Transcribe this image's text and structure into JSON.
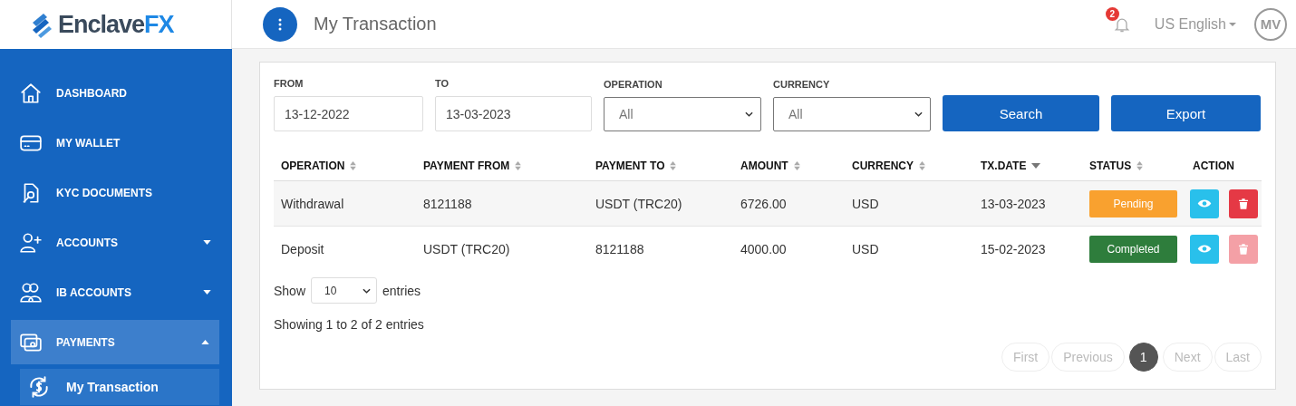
{
  "brand": {
    "name": "Enclave",
    "accent": "FX"
  },
  "header": {
    "title": "My Transaction",
    "notifications": "2",
    "language": "US English",
    "avatar": "MV"
  },
  "sidebar": {
    "items": [
      {
        "label": "DASHBOARD",
        "expandable": false,
        "selected": false
      },
      {
        "label": "MY WALLET",
        "expandable": false,
        "selected": false
      },
      {
        "label": "KYC DOCUMENTS",
        "expandable": false,
        "selected": false
      },
      {
        "label": "ACCOUNTS",
        "expandable": true,
        "expanded": false,
        "selected": false
      },
      {
        "label": "IB ACCOUNTS",
        "expandable": true,
        "expanded": false,
        "selected": false
      },
      {
        "label": "PAYMENTS",
        "expandable": true,
        "expanded": true,
        "selected": true,
        "children": [
          {
            "label": "My Transaction",
            "selected": true
          }
        ]
      }
    ]
  },
  "filters": {
    "from": {
      "label": "FROM",
      "value": "13-12-2022"
    },
    "to": {
      "label": "TO",
      "value": "13-03-2023"
    },
    "operation": {
      "label": "OPERATION",
      "value": "All"
    },
    "currency": {
      "label": "CURRENCY",
      "value": "All"
    },
    "buttons": [
      "Search",
      "Export"
    ]
  },
  "table": {
    "columns": [
      {
        "label": "OPERATION",
        "sortable": true,
        "sorted": false
      },
      {
        "label": "PAYMENT FROM",
        "sortable": true,
        "sorted": false
      },
      {
        "label": "PAYMENT TO",
        "sortable": true,
        "sorted": false
      },
      {
        "label": "AMOUNT",
        "sortable": true,
        "sorted": false
      },
      {
        "label": "CURRENCY",
        "sortable": true,
        "sorted": false
      },
      {
        "label": "TX.DATE",
        "sortable": true,
        "sorted": true
      },
      {
        "label": "STATUS",
        "sortable": true,
        "sorted": false
      },
      {
        "label": "ACTION",
        "sortable": false
      }
    ],
    "rows": [
      {
        "cells": [
          "Withdrawal",
          "8121188",
          "USDT (TRC20)",
          "6726.00",
          "USD",
          "13-03-2023"
        ],
        "status": {
          "label": "Pending",
          "kind": "pending"
        },
        "delete_disabled": false
      },
      {
        "cells": [
          "Deposit",
          "USDT (TRC20)",
          "8121188",
          "4000.00",
          "USD",
          "15-02-2023"
        ],
        "status": {
          "label": "Completed",
          "kind": "completed"
        },
        "delete_disabled": true
      }
    ]
  },
  "length": {
    "before": "Show",
    "value": "10",
    "after": "entries"
  },
  "info": "Showing 1 to 2 of 2 entries",
  "pagination": [
    {
      "label": "First",
      "selected": false
    },
    {
      "label": "Previous",
      "selected": false
    },
    {
      "label": "1",
      "selected": true
    },
    {
      "label": "Next",
      "selected": false
    },
    {
      "label": "Last",
      "selected": false
    }
  ]
}
